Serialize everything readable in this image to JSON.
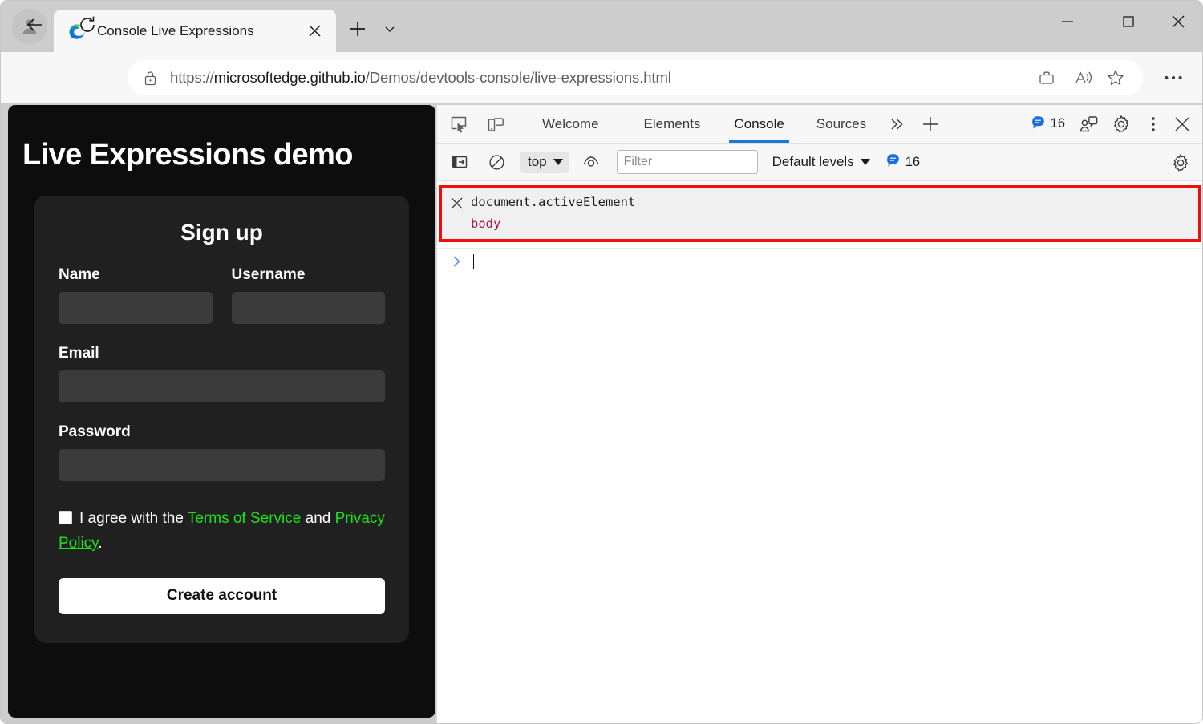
{
  "browser": {
    "profile_icon": "person-avatar-icon",
    "tab": {
      "favicon": "edge-logo-icon",
      "title": "Console Live Expressions",
      "close_icon": "close-icon"
    },
    "new_tab_icon": "plus-icon",
    "tab_list_icon": "chevron-down-icon",
    "window_controls": {
      "minimize": "minimize-icon",
      "maximize": "maximize-icon",
      "close": "close-icon"
    },
    "nav": {
      "back_icon": "arrow-left-icon",
      "reload_icon": "reload-icon",
      "lock_icon": "lock-icon",
      "url_scheme": "https://",
      "url_host": "microsoftedge.github.io",
      "url_path": "/Demos/devtools-console/live-expressions.html",
      "url_full": "https://microsoftedge.github.io/Demos/devtools-console/live-expressions.html",
      "collections_icon": "briefcase-icon",
      "read_aloud_icon": "read-aloud-icon",
      "favorites_icon": "star-icon",
      "settings_more_icon": "ellipsis-icon"
    }
  },
  "page": {
    "title": "Live Expressions demo",
    "card": {
      "heading": "Sign up",
      "fields": [
        {
          "label": "Name",
          "value": "",
          "type": "text"
        },
        {
          "label": "Username",
          "value": "",
          "type": "text"
        },
        {
          "label": "Email",
          "value": "",
          "type": "email"
        },
        {
          "label": "Password",
          "value": "",
          "type": "password"
        }
      ],
      "terms": {
        "checked": false,
        "text_before": "I agree with the ",
        "link_terms": "Terms of Service",
        "text_middle": " and ",
        "link_privacy": "Privacy Policy",
        "text_after": "."
      },
      "submit_label": "Create account",
      "link_color": "#1ae11a"
    }
  },
  "devtools": {
    "inspect_icon": "inspect-element-icon",
    "device_icon": "device-emulation-icon",
    "tabs": [
      {
        "label": "Welcome",
        "active": false
      },
      {
        "label": "Elements",
        "active": false
      },
      {
        "label": "Console",
        "active": true
      },
      {
        "label": "Sources",
        "active": false
      }
    ],
    "more_tabs_icon": "double-chevron-right-icon",
    "add_tab_icon": "plus-icon",
    "issues_count": "16",
    "issues_icon": "issues-message-icon",
    "feedback_icon": "feedback-icon",
    "settings_icon": "gear-icon",
    "kebab_icon": "more-vertical-icon",
    "close_icon": "close-icon",
    "active_tab_accent": "#1a7bd4",
    "console_toolbar": {
      "sidebar_icon": "console-sidebar-icon",
      "clear_icon": "clear-console-icon",
      "context_label": "top",
      "context_caret_icon": "caret-down-icon",
      "live_expression_icon": "eye-icon",
      "filter_placeholder": "Filter",
      "filter_value": "",
      "levels_label": "Default levels",
      "levels_caret_icon": "caret-down-icon",
      "issues_count": "16",
      "issues_icon": "issues-message-icon",
      "settings_icon": "gear-icon"
    },
    "live_expression": {
      "remove_icon": "close-icon",
      "expression": "document.activeElement",
      "value": "body",
      "value_color": "#a31545",
      "highlight_color": "#f20d0d",
      "background": "#f0f0f0"
    },
    "prompt": {
      "chevron_icon": "chevron-right-icon",
      "input_value": ""
    }
  }
}
